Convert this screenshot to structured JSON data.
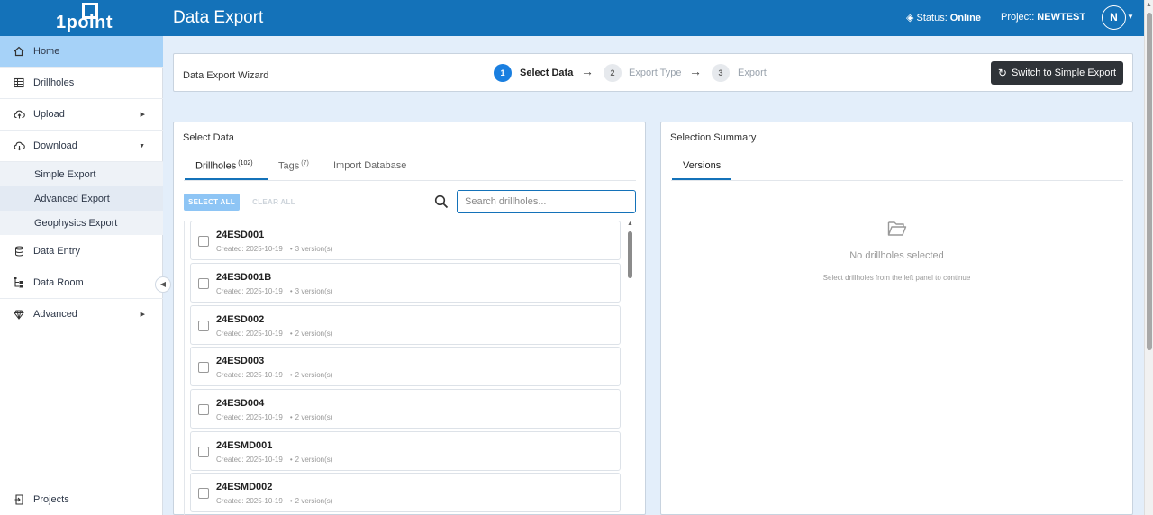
{
  "app": {
    "logo": "1point",
    "title": "Data Export",
    "status_label": "Status:",
    "status_value": "Online",
    "project_label": "Project:",
    "project_value": "NEWTEST",
    "user_initial": "N"
  },
  "sidebar": {
    "home": "Home",
    "drillholes": "Drillholes",
    "upload": "Upload",
    "download": "Download",
    "sub": [
      "Simple Export",
      "Advanced Export",
      "Geophysics Export"
    ],
    "data_entry": "Data Entry",
    "data_room": "Data Room",
    "advanced": "Advanced",
    "projects": "Projects"
  },
  "wizard": {
    "title": "Data Export Wizard",
    "steps": [
      {
        "num": "1",
        "label": "Select Data"
      },
      {
        "num": "2",
        "label": "Export Type"
      },
      {
        "num": "3",
        "label": "Export"
      }
    ],
    "switch_label": "Switch to Simple Export"
  },
  "select_panel": {
    "title": "Select Data",
    "tabs": [
      {
        "label": "Drillholes",
        "count": "(102)"
      },
      {
        "label": "Tags",
        "count": "(7)"
      },
      {
        "label": "Import Database",
        "count": ""
      }
    ],
    "select_all": "SELECT ALL",
    "clear_all": "CLEAR ALL",
    "search_placeholder": "Search drillholes...",
    "items": [
      {
        "name": "24ESD001",
        "created": "Created: 2025-10-19",
        "versions": "3 version(s)"
      },
      {
        "name": "24ESD001B",
        "created": "Created: 2025-10-19",
        "versions": "3 version(s)"
      },
      {
        "name": "24ESD002",
        "created": "Created: 2025-10-19",
        "versions": "2 version(s)"
      },
      {
        "name": "24ESD003",
        "created": "Created: 2025-10-19",
        "versions": "2 version(s)"
      },
      {
        "name": "24ESD004",
        "created": "Created: 2025-10-19",
        "versions": "2 version(s)"
      },
      {
        "name": "24ESMD001",
        "created": "Created: 2025-10-19",
        "versions": "2 version(s)"
      },
      {
        "name": "24ESMD002",
        "created": "Created: 2025-10-19",
        "versions": "2 version(s)"
      }
    ]
  },
  "summary_panel": {
    "title": "Selection Summary",
    "tab": "Versions",
    "empty_title": "No drillholes selected",
    "empty_subtitle": "Select drillholes from the left panel to continue"
  },
  "colors": {
    "header": "#1472b9",
    "active_nav": "#a6d2f8",
    "step_active": "#1a7fe0"
  }
}
